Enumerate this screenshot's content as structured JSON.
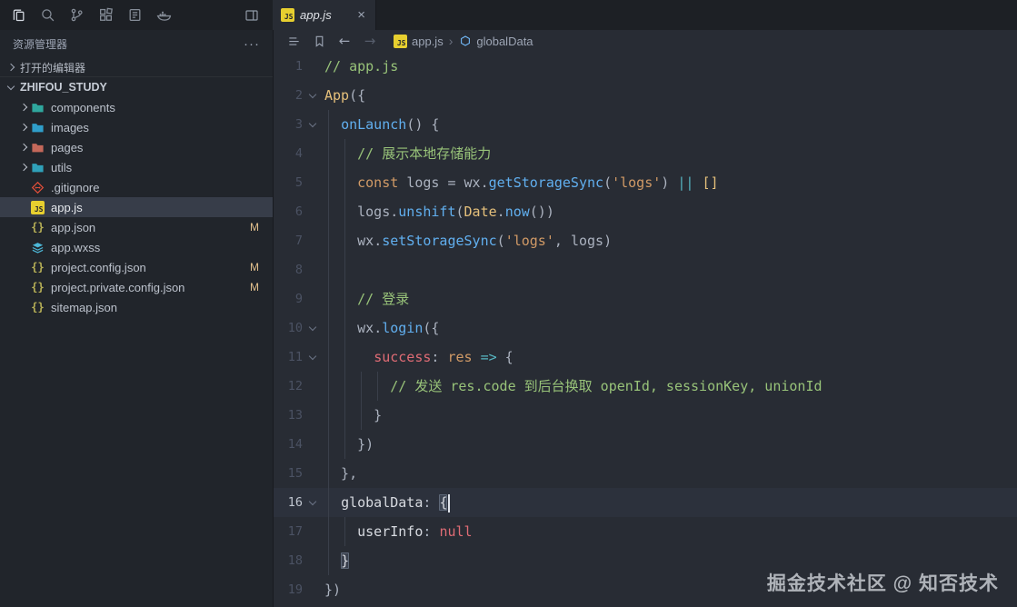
{
  "topbar": {
    "icons": [
      {
        "name": "explorer"
      },
      {
        "name": "search"
      },
      {
        "name": "source-control"
      },
      {
        "name": "extensions"
      },
      {
        "name": "remote"
      },
      {
        "name": "docker"
      }
    ],
    "layout_icon": "layout",
    "tab": {
      "label": "app.js",
      "close": "×"
    }
  },
  "sidebar": {
    "title": "资源管理器",
    "menu_dots": "···",
    "open_editors_label": "打开的编辑器",
    "workspace_label": "ZHIFOU_STUDY",
    "tree": [
      {
        "type": "folder",
        "label": "components",
        "color": "#2fa79e"
      },
      {
        "type": "folder",
        "label": "images",
        "color": "#2f9ec9"
      },
      {
        "type": "folder",
        "label": "pages",
        "color": "#c4685a"
      },
      {
        "type": "folder",
        "label": "utils",
        "color": "#2fa0b8"
      },
      {
        "type": "file",
        "icon": "git",
        "label": ".gitignore"
      },
      {
        "type": "file",
        "icon": "js",
        "label": "app.js",
        "selected": true
      },
      {
        "type": "file",
        "icon": "json",
        "label": "app.json",
        "badge": "M"
      },
      {
        "type": "file",
        "icon": "wxss",
        "label": "app.wxss"
      },
      {
        "type": "file",
        "icon": "json",
        "label": "project.config.json",
        "badge": "M"
      },
      {
        "type": "file",
        "icon": "json",
        "label": "project.private.config.json",
        "badge": "M"
      },
      {
        "type": "file",
        "icon": "json",
        "label": "sitemap.json"
      }
    ]
  },
  "editor": {
    "toolbar_icons": [
      {
        "name": "outline",
        "dim": false
      },
      {
        "name": "bookmark",
        "dim": false
      },
      {
        "name": "nav-back",
        "dim": false
      },
      {
        "name": "nav-forward",
        "dim": true
      }
    ],
    "breadcrumb": {
      "file": "app.js",
      "separator": "›",
      "symbol": "globalData"
    },
    "active_line": 16,
    "palette": {
      "c": "#98c379",
      "kw": "#d19a66",
      "cls": "#e5c07b",
      "fn": "#61afef",
      "v": "#abb2bf",
      "str": "#d19a66",
      "prop": "#e06c75",
      "param": "#d19a66",
      "op2": "#56b6c2",
      "arr": "#e5c07b",
      "p": "#abb2bf",
      "key": "#d7dae0",
      "nul": "#e06c75",
      "bm": "#d7dae0"
    },
    "lines": [
      {
        "n": 1,
        "segs": [
          [
            "// app.js",
            "c"
          ]
        ]
      },
      {
        "n": 2,
        "fold": true,
        "segs": [
          [
            "App",
            "cls"
          ],
          [
            "({",
            "p"
          ]
        ]
      },
      {
        "n": 3,
        "fold": true,
        "segs": [
          [
            "  ",
            "p"
          ],
          [
            "onLaunch",
            "fn"
          ],
          [
            "() {",
            "p"
          ]
        ]
      },
      {
        "n": 4,
        "segs": [
          [
            "    ",
            "p"
          ],
          [
            "// 展示本地存储能力",
            "c"
          ]
        ]
      },
      {
        "n": 5,
        "segs": [
          [
            "    ",
            "p"
          ],
          [
            "const",
            "kw"
          ],
          [
            " ",
            "p"
          ],
          [
            "logs",
            "v"
          ],
          [
            " = ",
            "p"
          ],
          [
            "wx",
            "v"
          ],
          [
            ".",
            "p"
          ],
          [
            "getStorageSync",
            "fn"
          ],
          [
            "(",
            "p"
          ],
          [
            "'logs'",
            "str"
          ],
          [
            ") ",
            "p"
          ],
          [
            "||",
            "op2"
          ],
          [
            " ",
            "p"
          ],
          [
            "[]",
            "arr"
          ]
        ]
      },
      {
        "n": 6,
        "segs": [
          [
            "    ",
            "p"
          ],
          [
            "logs",
            "v"
          ],
          [
            ".",
            "p"
          ],
          [
            "unshift",
            "fn"
          ],
          [
            "(",
            "p"
          ],
          [
            "Date",
            "cls"
          ],
          [
            ".",
            "p"
          ],
          [
            "now",
            "fn"
          ],
          [
            "())",
            "p"
          ]
        ]
      },
      {
        "n": 7,
        "segs": [
          [
            "    ",
            "p"
          ],
          [
            "wx",
            "v"
          ],
          [
            ".",
            "p"
          ],
          [
            "setStorageSync",
            "fn"
          ],
          [
            "(",
            "p"
          ],
          [
            "'logs'",
            "str"
          ],
          [
            ", ",
            "p"
          ],
          [
            "logs",
            "v"
          ],
          [
            ")",
            "p"
          ]
        ]
      },
      {
        "n": 8,
        "segs": []
      },
      {
        "n": 9,
        "segs": [
          [
            "    ",
            "p"
          ],
          [
            "// 登录",
            "c"
          ]
        ]
      },
      {
        "n": 10,
        "fold": true,
        "segs": [
          [
            "    ",
            "p"
          ],
          [
            "wx",
            "v"
          ],
          [
            ".",
            "p"
          ],
          [
            "login",
            "fn"
          ],
          [
            "({",
            "p"
          ]
        ]
      },
      {
        "n": 11,
        "fold": true,
        "segs": [
          [
            "      ",
            "p"
          ],
          [
            "success",
            "prop"
          ],
          [
            ": ",
            "p"
          ],
          [
            "res",
            "param"
          ],
          [
            " ",
            "p"
          ],
          [
            "=>",
            "op2"
          ],
          [
            " {",
            "p"
          ]
        ]
      },
      {
        "n": 12,
        "segs": [
          [
            "        ",
            "p"
          ],
          [
            "// 发送 res.code 到后台换取 openId, sessionKey, unionId",
            "c"
          ]
        ]
      },
      {
        "n": 13,
        "segs": [
          [
            "      }",
            "p"
          ]
        ]
      },
      {
        "n": 14,
        "segs": [
          [
            "    })",
            "p"
          ]
        ]
      },
      {
        "n": 15,
        "segs": [
          [
            "  },",
            "p"
          ]
        ]
      },
      {
        "n": 16,
        "fold": true,
        "cursor": true,
        "segs": [
          [
            "  ",
            "p"
          ],
          [
            "globalData",
            "key"
          ],
          [
            ": ",
            "p"
          ],
          [
            "{",
            "bm"
          ]
        ]
      },
      {
        "n": 17,
        "segs": [
          [
            "    ",
            "p"
          ],
          [
            "userInfo",
            "key"
          ],
          [
            ": ",
            "p"
          ],
          [
            "null",
            "nul"
          ]
        ]
      },
      {
        "n": 18,
        "segs": [
          [
            "  ",
            "p"
          ],
          [
            "}",
            "bm"
          ]
        ]
      },
      {
        "n": 19,
        "segs": [
          [
            "})",
            "p"
          ]
        ]
      }
    ]
  },
  "watermark": "掘金技术社区 @ 知否技术"
}
